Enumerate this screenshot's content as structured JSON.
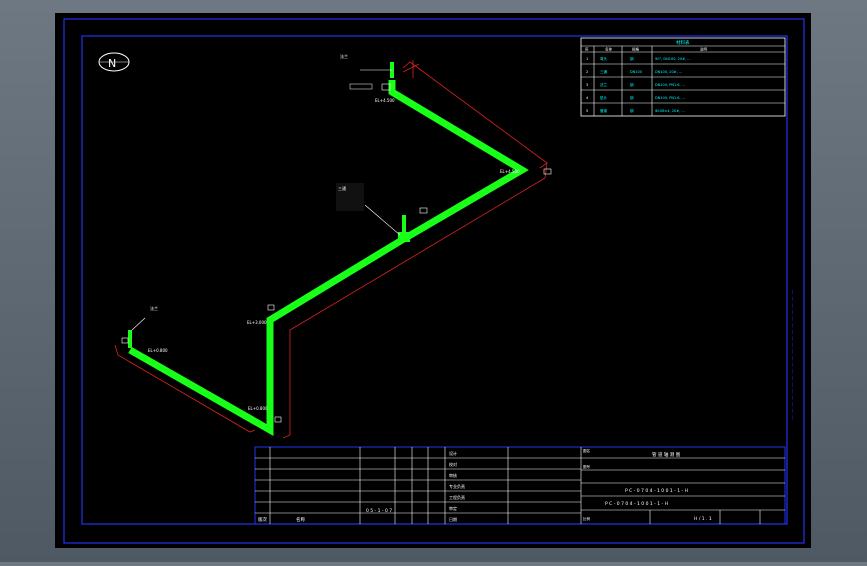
{
  "north_symbol": {
    "label": "N"
  },
  "parts_table": {
    "title": "材料表",
    "headers": [
      "序",
      "名称",
      "规格",
      "说明"
    ],
    "rows": [
      {
        "no": "1",
        "name": "弯头",
        "spec": "钢",
        "note": "90°, DN100, 20#, ..."
      },
      {
        "no": "2",
        "name": "三通",
        "spec": "DN100",
        "note": "DN100, 20#, ..."
      },
      {
        "no": "3",
        "name": "法兰",
        "spec": "钢",
        "note": "DN100, PN1.6, ..."
      },
      {
        "no": "4",
        "name": "垫片",
        "spec": "钢",
        "note": "DN100, PN1.6, ..."
      },
      {
        "no": "5",
        "name": "管道",
        "spec": "钢",
        "note": "Φ108×4, 20#, ..."
      }
    ]
  },
  "title_block": {
    "drawing_title": "管 道 轴 测 图",
    "drawing_no": "P C - 0 7 0 4 - 1 0 0 1 - 1 - H",
    "drawing_no_2": "P C - 0 7 0 4 - 1 0 0 1 - 1 - H",
    "sheet": "H / 1 . 1",
    "scale_label": "比例",
    "middle_note": "0 5 - 1 - 0 7",
    "rev_label": "版次",
    "name_label": "名称",
    "labels": [
      "设计",
      "校对",
      "审核",
      "专业负责",
      "工程负责",
      "审定",
      "日期"
    ],
    "top_cells": [
      "图名",
      "图号",
      "版次"
    ]
  },
  "annotations": {
    "top_flange": "法兰",
    "elbow_top": "EL+4.500",
    "elbow_right": "EL+4.500",
    "tee": "三通",
    "elbow_mid": "EL+3.000",
    "elbow_low": "EL+0.800",
    "left_end": "EL+0.800",
    "left_flange": "法兰"
  }
}
